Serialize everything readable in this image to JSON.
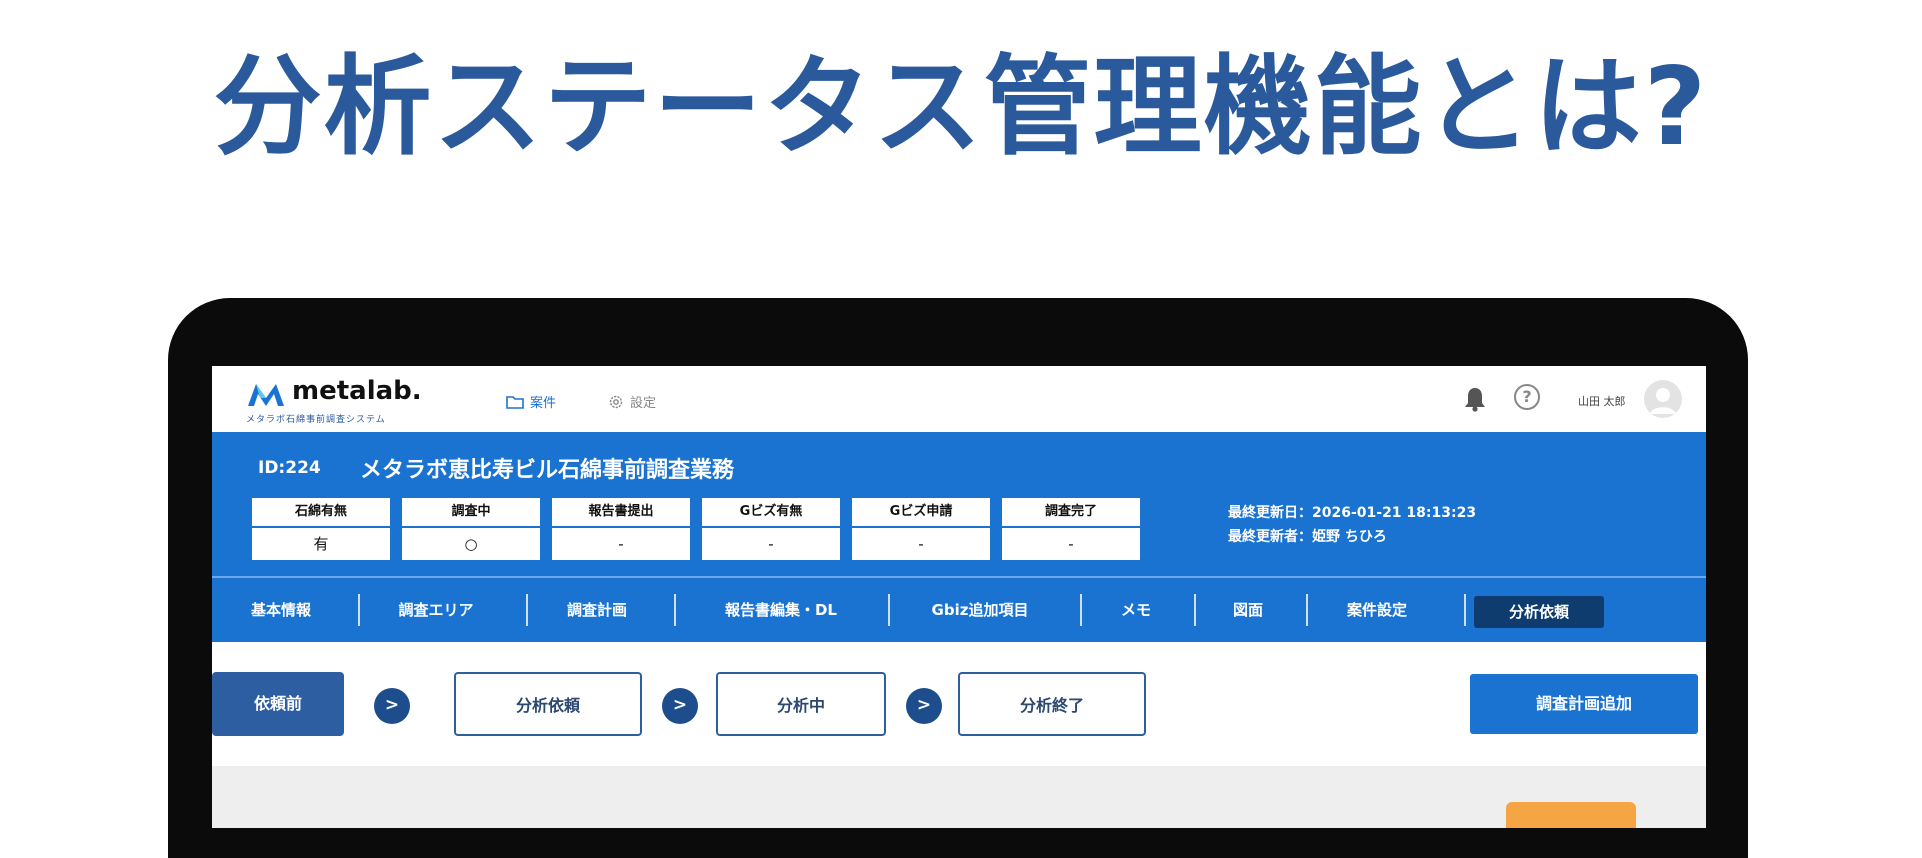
{
  "headline": "分析ステータス管理機能とは?",
  "topbar": {
    "logo_text": "metalab.",
    "logo_sub": "メタラボ石綿事前調査システム",
    "nav_case": "案件",
    "nav_settings": "設定",
    "help_symbol": "?",
    "user_name": "山田 太郎"
  },
  "project": {
    "id": "ID:224",
    "name": "メタラボ恵比寿ビル石綿事前調査業務",
    "statuses": [
      {
        "label": "石綿有無",
        "value": "有"
      },
      {
        "label": "調査中",
        "value": "○"
      },
      {
        "label": "報告書提出",
        "value": "-"
      },
      {
        "label": "Gビズ有無",
        "value": "-"
      },
      {
        "label": "Gビズ申請",
        "value": "-"
      },
      {
        "label": "調査完了",
        "value": "-"
      }
    ],
    "last_updated": "最終更新日：2026-01-21 18:13:23",
    "last_updated_by": "最終更新者：姫野 ちひろ"
  },
  "tabs": [
    {
      "label": "基本情報"
    },
    {
      "label": "調査エリア"
    },
    {
      "label": "調査計画"
    },
    {
      "label": "報告書編集・DL"
    },
    {
      "label": "Gbiz追加項目"
    },
    {
      "label": "メモ"
    },
    {
      "label": "図面"
    },
    {
      "label": "案件設定"
    },
    {
      "label": "分析依頼"
    }
  ],
  "workflow": {
    "steps": [
      {
        "label": "依頼前"
      },
      {
        "label": "分析依頼"
      },
      {
        "label": "分析中"
      },
      {
        "label": "分析終了"
      }
    ],
    "arrow_symbol": ">",
    "add_plan_button": "調査計画追加"
  },
  "colors": {
    "headline": "#2b5a9c",
    "primary_blue": "#1a73d1",
    "active_tab": "#0e3c6e",
    "current_step": "#2d5ea2",
    "orange": "#f6a545"
  }
}
